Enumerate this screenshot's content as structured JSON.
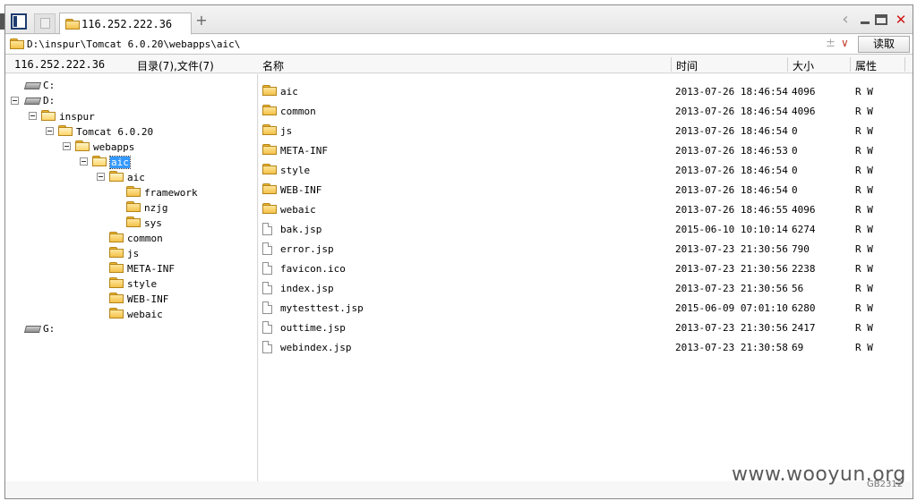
{
  "tab": {
    "title": "116.252.222.36",
    "new_tab_icon": "plus-icon"
  },
  "window": {
    "controls": [
      "back-icon",
      "minimize-icon",
      "maximize-icon",
      "close-icon"
    ]
  },
  "pathbar": {
    "path": "D:\\inspur\\Tomcat 6.0.20\\webapps\\aic\\",
    "read_button": "读取",
    "plus_symbol": "±",
    "dropdown_symbol": "∨"
  },
  "left_header": {
    "host": "116.252.222.36",
    "counts": "目录(7),文件(7)"
  },
  "columns": {
    "name": "名称",
    "time": "时间",
    "size": "大小",
    "attr": "属性"
  },
  "tree": [
    {
      "label": "C:",
      "type": "drive"
    },
    {
      "label": "D:",
      "type": "drive"
    },
    {
      "label": "inspur",
      "type": "folder"
    },
    {
      "label": "Tomcat 6.0.20",
      "type": "folder"
    },
    {
      "label": "webapps",
      "type": "folder"
    },
    {
      "label": "aic",
      "type": "folder",
      "selected": true
    },
    {
      "label": "aic",
      "type": "folder"
    },
    {
      "label": "framework",
      "type": "folder"
    },
    {
      "label": "nzjg",
      "type": "folder"
    },
    {
      "label": "sys",
      "type": "folder"
    },
    {
      "label": "common",
      "type": "folder"
    },
    {
      "label": "js",
      "type": "folder"
    },
    {
      "label": "META-INF",
      "type": "folder"
    },
    {
      "label": "style",
      "type": "folder"
    },
    {
      "label": "WEB-INF",
      "type": "folder"
    },
    {
      "label": "webaic",
      "type": "folder"
    },
    {
      "label": "G:",
      "type": "drive"
    }
  ],
  "files": [
    {
      "name": "aic",
      "time": "2013-07-26 18:46:54",
      "size": "4096",
      "attr": "R W",
      "type": "folder"
    },
    {
      "name": "common",
      "time": "2013-07-26 18:46:54",
      "size": "4096",
      "attr": "R W",
      "type": "folder"
    },
    {
      "name": "js",
      "time": "2013-07-26 18:46:54",
      "size": "0",
      "attr": "R W",
      "type": "folder"
    },
    {
      "name": "META-INF",
      "time": "2013-07-26 18:46:53",
      "size": "0",
      "attr": "R W",
      "type": "folder"
    },
    {
      "name": "style",
      "time": "2013-07-26 18:46:54",
      "size": "0",
      "attr": "R W",
      "type": "folder"
    },
    {
      "name": "WEB-INF",
      "time": "2013-07-26 18:46:54",
      "size": "0",
      "attr": "R W",
      "type": "folder"
    },
    {
      "name": "webaic",
      "time": "2013-07-26 18:46:55",
      "size": "4096",
      "attr": "R W",
      "type": "folder"
    },
    {
      "name": "bak.jsp",
      "time": "2015-06-10 10:10:14",
      "size": "6274",
      "attr": "R W",
      "type": "file"
    },
    {
      "name": "error.jsp",
      "time": "2013-07-23 21:30:56",
      "size": "790",
      "attr": "R W",
      "type": "file"
    },
    {
      "name": "favicon.ico",
      "time": "2013-07-23 21:30:56",
      "size": "2238",
      "attr": "R W",
      "type": "file"
    },
    {
      "name": "index.jsp",
      "time": "2013-07-23 21:30:56",
      "size": "56",
      "attr": "R W",
      "type": "file"
    },
    {
      "name": "mytesttest.jsp",
      "time": "2015-06-09 07:01:10",
      "size": "6280",
      "attr": "R W",
      "type": "file"
    },
    {
      "name": "outtime.jsp",
      "time": "2013-07-23 21:30:56",
      "size": "2417",
      "attr": "R W",
      "type": "file"
    },
    {
      "name": "webindex.jsp",
      "time": "2013-07-23 21:30:58",
      "size": "69",
      "attr": "R W",
      "type": "file"
    }
  ],
  "watermark": "www.wooyun.org",
  "corner_text": "GB2312"
}
